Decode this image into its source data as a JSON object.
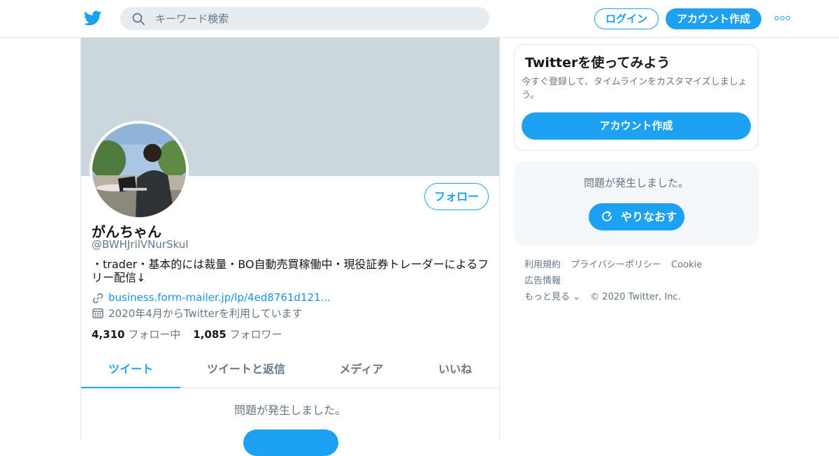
{
  "header": {
    "logo_icon": "twitter-bird-icon",
    "search": {
      "placeholder": "キーワード検索",
      "icon": "search-icon"
    },
    "login_label": "ログイン",
    "signup_label": "アカウント作成",
    "more_icon": "more-dots-icon"
  },
  "profile": {
    "display_name": "がんちゃん",
    "handle": "@BWHJrilVNurSkuI",
    "bio": "・trader・基本的には裁量・BO自動売買稼働中・現役証券トレーダーによるフリー配信↓",
    "link": "business.form-mailer.jp/lp/4ed8761d121...",
    "joined": "2020年4月からTwitterを利用しています",
    "following_count": "4,310",
    "following_label": "フォロー中",
    "followers_count": "1,085",
    "followers_label": "フォロワー",
    "follow_button": "フォロー"
  },
  "tabs": [
    {
      "label": "ツイート",
      "active": true
    },
    {
      "label": "ツイートと返信",
      "active": false
    },
    {
      "label": "メディア",
      "active": false
    },
    {
      "label": "いいね",
      "active": false
    }
  ],
  "timeline": {
    "error_text": "問題が発生しました。"
  },
  "sidebar": {
    "card_title": "Twitterを使ってみよう",
    "card_subtitle": "今すぐ登録して、タイムラインをカスタマイズしましょう。",
    "card_button": "アカウント作成",
    "error_text": "問題が発生しました。",
    "retry_label": "やりなおす"
  },
  "footer": {
    "links": [
      "利用規約",
      "プライバシーポリシー",
      "Cookie",
      "広告情報",
      "もっと見る ⌄"
    ],
    "copyright": "© 2020 Twitter, Inc."
  },
  "colors": {
    "accent": "#1da1f2",
    "banner": "#ccd6dd",
    "muted": "#657786"
  }
}
